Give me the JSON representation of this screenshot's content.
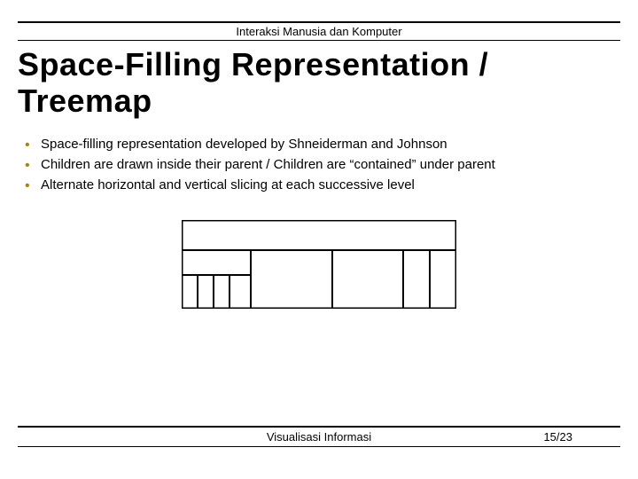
{
  "header": {
    "course": "Interaksi Manusia dan Komputer"
  },
  "title": "Space-Filling Representation / Treemap",
  "bullets": [
    "Space-filling representation developed by Shneiderman and Johnson",
    "Children are drawn inside their parent / Children are “contained” under parent",
    "Alternate horizontal and vertical slicing at each successive level"
  ],
  "footer": {
    "subject": "Visualisasi Informasi",
    "page": "15/23"
  }
}
